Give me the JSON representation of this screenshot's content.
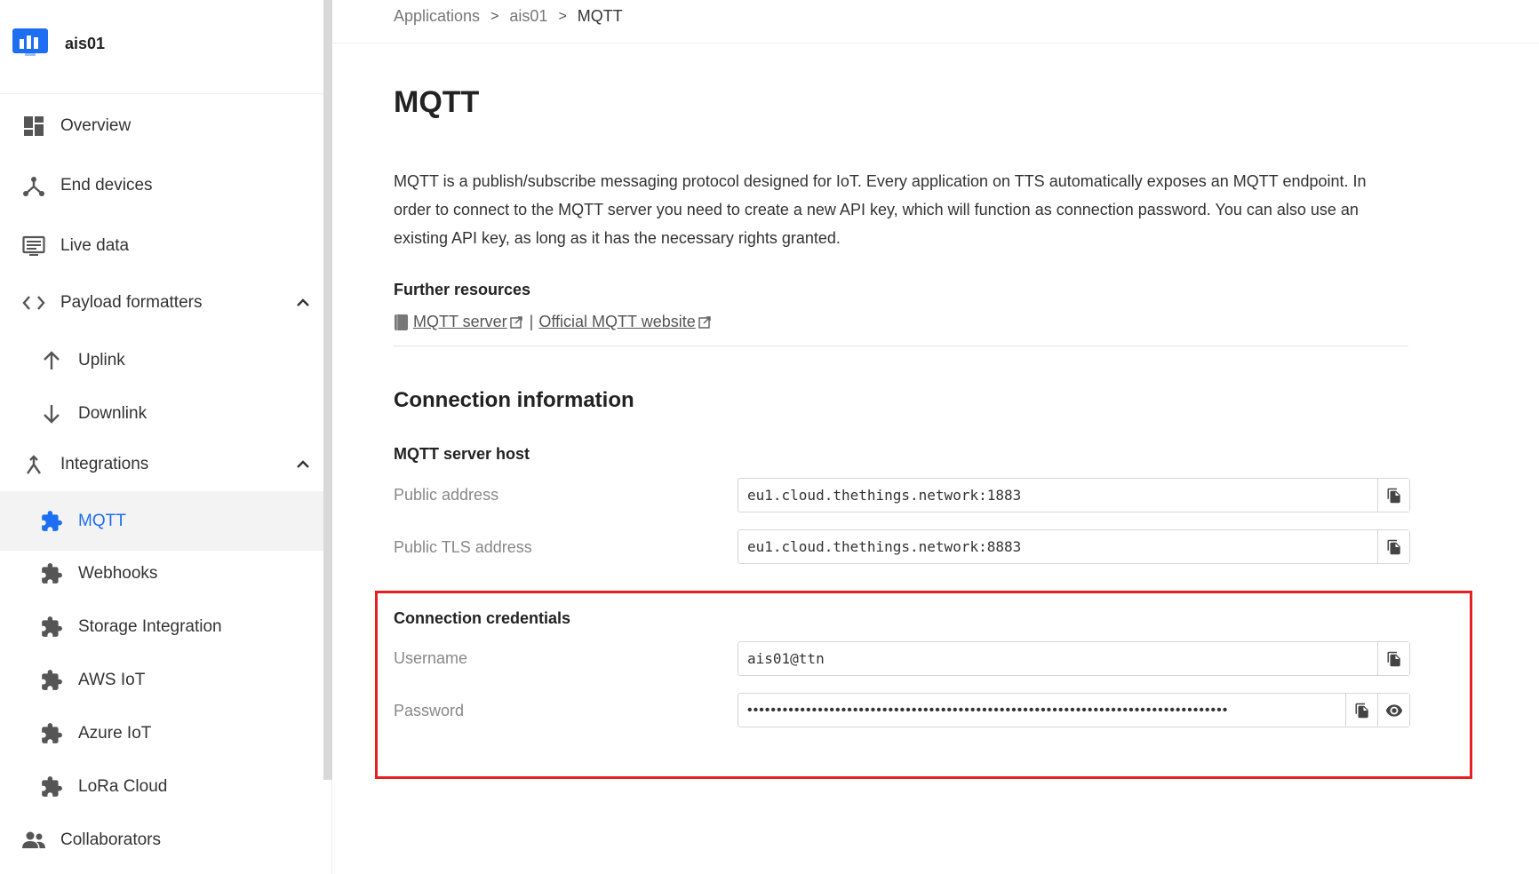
{
  "app": {
    "name": "ais01"
  },
  "sidebar": {
    "items": [
      {
        "label": "Overview",
        "icon": "overview-icon"
      },
      {
        "label": "End devices",
        "icon": "end-devices-icon"
      },
      {
        "label": "Live data",
        "icon": "live-data-icon"
      },
      {
        "label": "Payload formatters",
        "icon": "code-icon",
        "expanded": true
      },
      {
        "label": "Uplink",
        "icon": "arrow-up-icon"
      },
      {
        "label": "Downlink",
        "icon": "arrow-down-icon"
      },
      {
        "label": "Integrations",
        "icon": "integrations-icon",
        "expanded": true
      },
      {
        "label": "MQTT",
        "icon": "puzzle-icon",
        "active": true
      },
      {
        "label": "Webhooks",
        "icon": "puzzle-icon"
      },
      {
        "label": "Storage Integration",
        "icon": "puzzle-icon"
      },
      {
        "label": "AWS IoT",
        "icon": "puzzle-icon"
      },
      {
        "label": "Azure IoT",
        "icon": "puzzle-icon"
      },
      {
        "label": "LoRa Cloud",
        "icon": "puzzle-icon"
      },
      {
        "label": "Collaborators",
        "icon": "collaborators-icon"
      }
    ]
  },
  "breadcrumb": {
    "items": [
      "Applications",
      "ais01",
      "MQTT"
    ],
    "separator": ">"
  },
  "page": {
    "title": "MQTT",
    "intro": "MQTT is a publish/subscribe messaging protocol designed for IoT. Every application on TTS automatically exposes an MQTT endpoint. In order to connect to the MQTT server you need to create a new API key, which will function as connection password. You can also use an existing API key, as long as it has the necessary rights granted.",
    "resources": {
      "heading": "Further resources",
      "link1": "MQTT server",
      "divider": "|",
      "link2": "Official MQTT website"
    },
    "connection": {
      "heading": "Connection information",
      "server_host": {
        "heading": "MQTT server host",
        "public_address_label": "Public address",
        "public_address": "eu1.cloud.thethings.network:1883",
        "public_tls_label": "Public TLS address",
        "public_tls": "eu1.cloud.thethings.network:8883"
      },
      "credentials": {
        "heading": "Connection credentials",
        "username_label": "Username",
        "username": "ais01@ttn",
        "password_label": "Password",
        "password_mask": "••••••••••••••••••••••••••••••••••••••••••••••••••••••••••••••••••••••••••••••••••"
      }
    }
  },
  "colors": {
    "accent": "#1d6ef2",
    "highlight_border": "#e62020",
    "icon": "#555555"
  }
}
